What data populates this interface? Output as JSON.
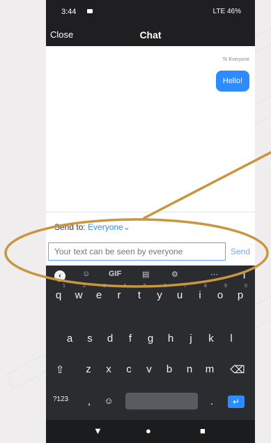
{
  "status": {
    "time": "3:44",
    "signals": "LTE 46%"
  },
  "header": {
    "close": "Close",
    "title": "Chat"
  },
  "messages": [
    {
      "to": "To Everyone",
      "text": "Hello!"
    }
  ],
  "composer": {
    "send_to_label": "Send to:",
    "send_to_value": "Everyone",
    "placeholder": "Your text can be seen by everyone",
    "send_label": "Send"
  },
  "keyboard": {
    "toolbar": [
      "GIF",
      "⋯"
    ],
    "rows": [
      [
        "q",
        "w",
        "e",
        "r",
        "t",
        "y",
        "u",
        "i",
        "o",
        "p"
      ],
      [
        "a",
        "s",
        "d",
        "f",
        "g",
        "h",
        "j",
        "k",
        "l"
      ],
      [
        "z",
        "x",
        "c",
        "v",
        "b",
        "n",
        "m"
      ]
    ],
    "hints": [
      "1",
      "2",
      "3",
      "4",
      "5",
      "6",
      "7",
      "8",
      "9",
      "0"
    ],
    "symbols_key": "?123",
    "comma": ",",
    "period": "."
  }
}
